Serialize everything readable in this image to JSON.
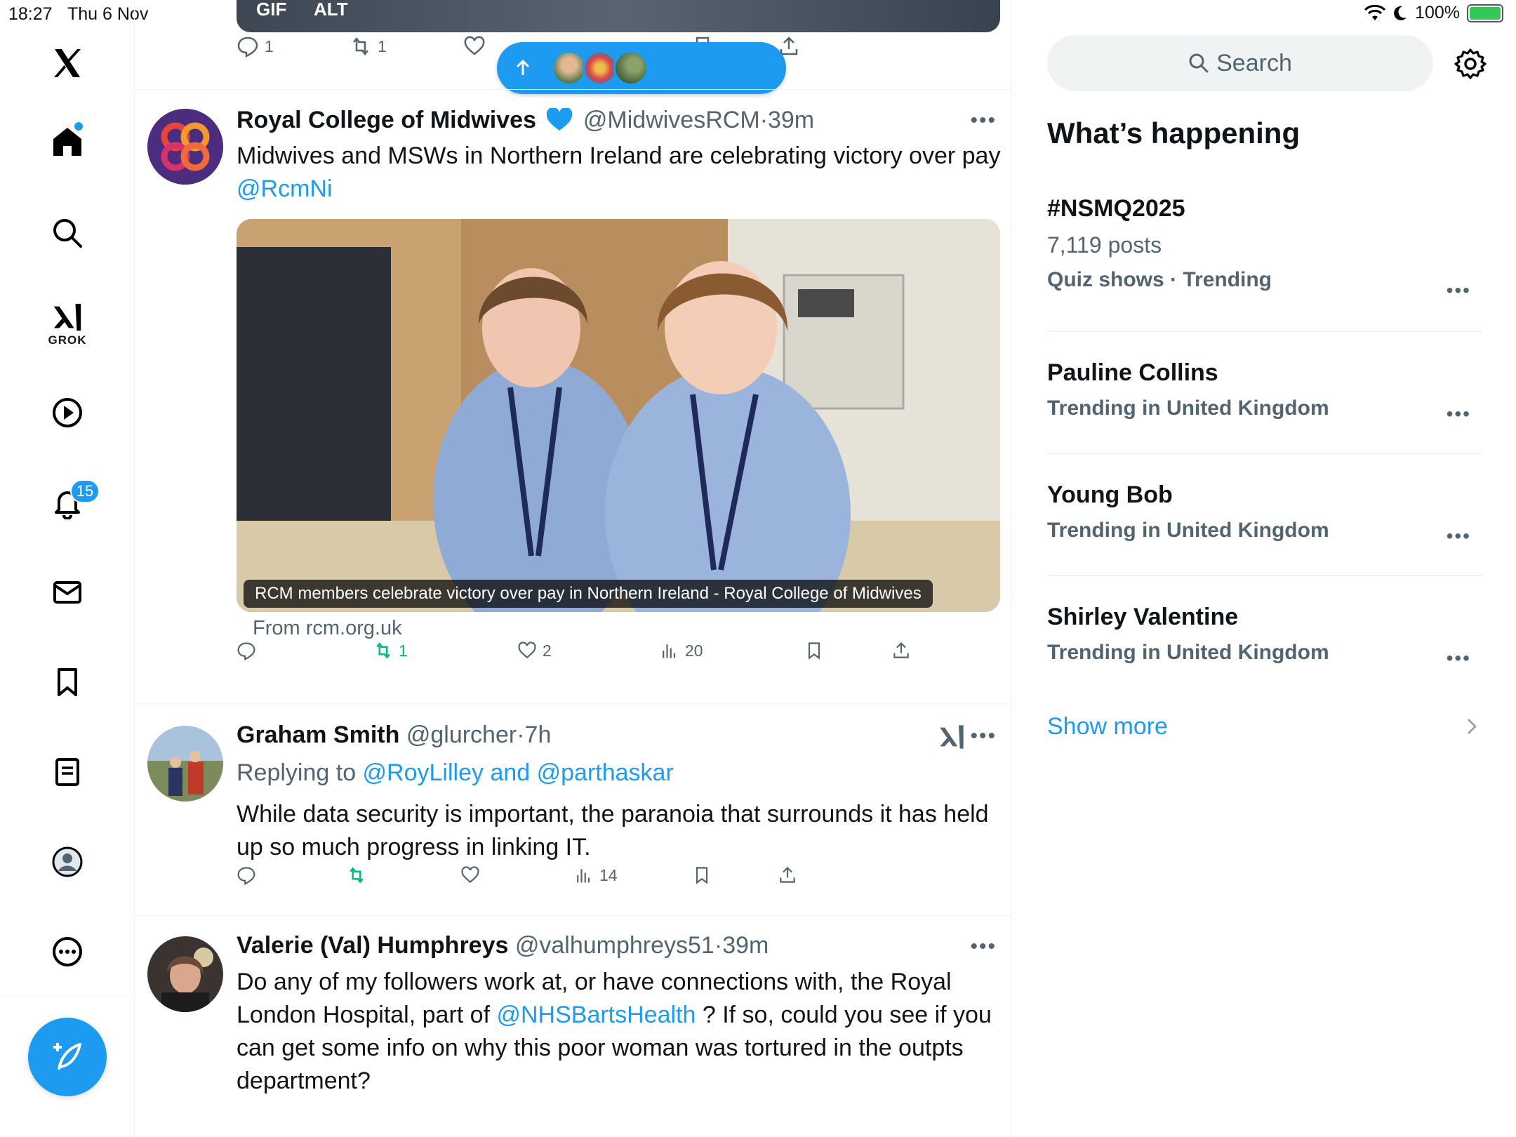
{
  "status": {
    "time": "18:27",
    "date": "Thu 6 Nov",
    "battery": "100%"
  },
  "nav": {
    "grok_label": "GROK",
    "notifications_badge": "15"
  },
  "top_post": {
    "media_tags": [
      "GIF",
      "ALT"
    ],
    "replies": "1",
    "reposts": "1"
  },
  "tweets": [
    {
      "name": "Royal College of Midwives",
      "handle": "@MidwivesRCM",
      "time": "39m",
      "text": "Midwives and MSWs in Northern Ireland are celebrating victory over pay ",
      "mention": "@RcmNi",
      "card_caption": "RCM members celebrate victory over pay in Northern Ireland - Royal College of Midwives",
      "card_source": "From rcm.org.uk",
      "reposts": "1",
      "likes": "2",
      "views": "20"
    },
    {
      "name": "Graham Smith",
      "handle": "@glurcher",
      "time": "7h",
      "reply_prefix": "Replying to ",
      "reply_to": "@RoyLilley and @parthaskar",
      "text": "While data security is important, the paranoia that surrounds it has held up so much progress in linking IT.",
      "views": "14"
    },
    {
      "name": "Valerie (Val) Humphreys",
      "handle": "@valhumphreys51",
      "time": "39m",
      "text_a": "Do any of my followers work at, or have connections with, the Royal London Hospital, part of ",
      "mention": "@NHSBartsHealth",
      "text_b": " ? If so, could you see if you can get some info on why this poor woman was tortured in the outpts department?"
    }
  ],
  "right": {
    "search_placeholder": "Search",
    "title": "What’s happening",
    "trends": [
      {
        "name": "#NSMQ2025",
        "count": "7,119 posts",
        "context": "Quiz shows · Trending"
      },
      {
        "name": "Pauline Collins",
        "context": "Trending in United Kingdom"
      },
      {
        "name": "Young Bob",
        "context": "Trending in United Kingdom"
      },
      {
        "name": "Shirley Valentine",
        "context": "Trending in United Kingdom"
      }
    ],
    "show_more": "Show more"
  },
  "colors": {
    "accent": "#1d9bf0",
    "repost_green": "#00ba7c",
    "muted": "#536471"
  }
}
